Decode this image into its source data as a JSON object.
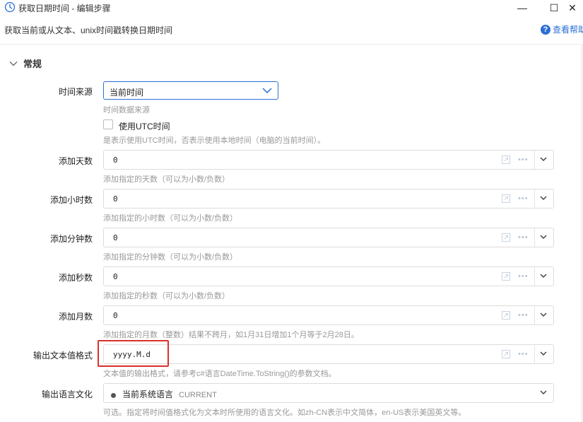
{
  "window": {
    "title": "获取日期时间 - 编辑步骤",
    "minimize_glyph": "—",
    "maximize_glyph": "☐",
    "close_glyph": "✕"
  },
  "description": "获取当前或从文本、unix时间戳转换日期时间",
  "help": {
    "label": "查看帮助",
    "icon_glyph": "?"
  },
  "section": {
    "title": "常规",
    "icon": "chevron-down-icon"
  },
  "time_source": {
    "label": "时间来源",
    "value": "当前时间",
    "hint": "时间数据来源"
  },
  "utc": {
    "label": "使用UTC时间",
    "checked": false,
    "hint": "是表示使用UTC时间，否表示使用本地时间（电脑的当前时间）。"
  },
  "fields": {
    "add_days": {
      "label": "添加天数",
      "value": "0",
      "hint": "添加指定的天数（可以为小数/负数）"
    },
    "add_hours": {
      "label": "添加小时数",
      "value": "0",
      "hint": "添加指定的小时数（可以为小数/负数）"
    },
    "add_minutes": {
      "label": "添加分钟数",
      "value": "0",
      "hint": "添加指定的分钟数（可以为小数/负数）"
    },
    "add_seconds": {
      "label": "添加秒数",
      "value": "0",
      "hint": "添加指定的秒数（可以为小数/负数）"
    },
    "add_months": {
      "label": "添加月数",
      "value": "0",
      "hint": "添加指定的月数（整数）结果不跨月，如1月31日增加1个月等于2月28日。"
    },
    "output_format": {
      "label": "输出文本值格式",
      "value": "yyyy.M.d",
      "hint": "文本值的输出格式，请参考c#语言DateTime.ToString()的参数文档。"
    }
  },
  "culture": {
    "label": "输出语言文化",
    "value_name": "当前系统语言",
    "value_code": "CURRENT",
    "hint": "可选。指定将时间值格式化为文本时所使用的语言文化。如zh-CN表示中文简体，en-US表示美国英文等。"
  },
  "colors": {
    "accent": "#2b6fd6",
    "highlight_border": "#d9302c",
    "hint_text": "#999999"
  }
}
